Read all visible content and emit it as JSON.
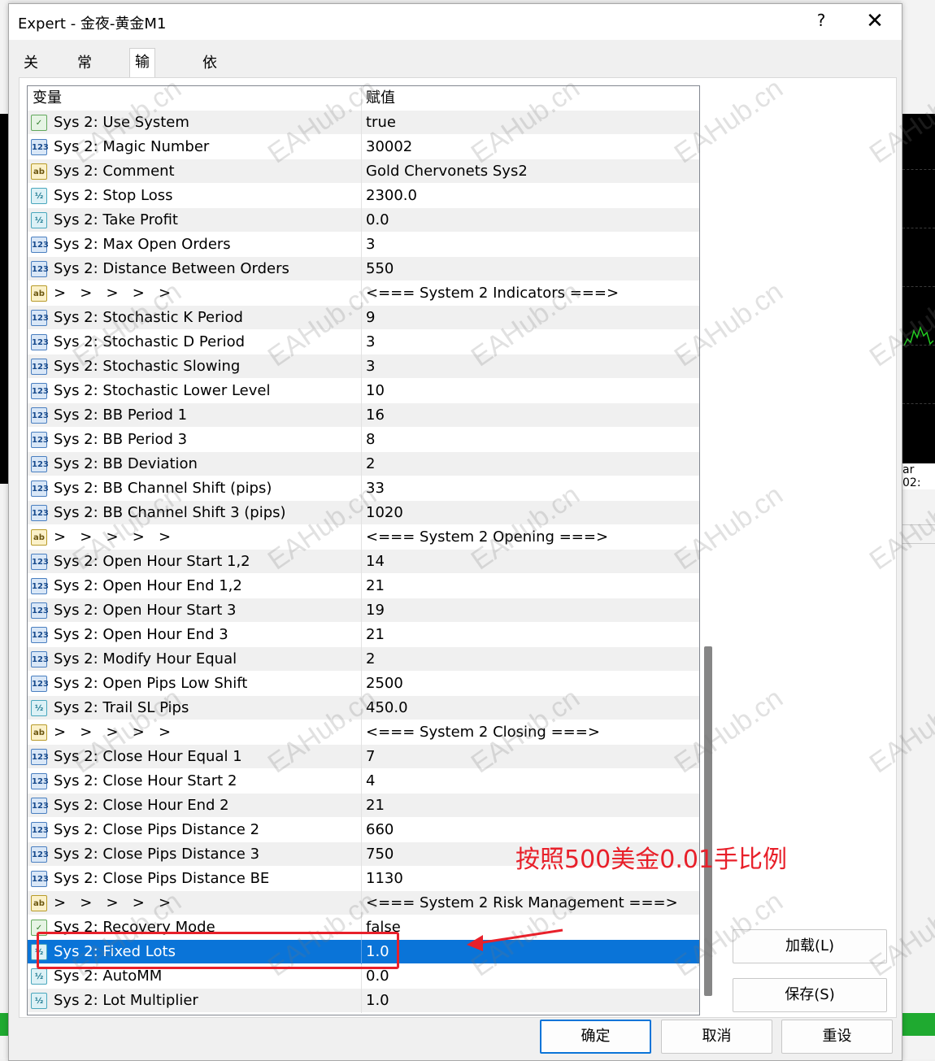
{
  "window": {
    "title": "Expert - 金夜-黄金M1",
    "help": "?",
    "close": "✕"
  },
  "tabs": [
    {
      "label": "关于"
    },
    {
      "label": "常用"
    },
    {
      "label": "输入参数",
      "active": true
    },
    {
      "label": "依存关系"
    }
  ],
  "table": {
    "col_variable": "变量",
    "col_value": "赋值",
    "rows": [
      {
        "type": "bool",
        "icon": "bool-icon",
        "name": "Sys 2: Use System",
        "value": "true"
      },
      {
        "type": "int",
        "icon": "int-icon",
        "name": "Sys 2: Magic Number",
        "value": "30002"
      },
      {
        "type": "str",
        "icon": "string-icon",
        "name": "Sys 2: Comment",
        "value": "Gold Chervonets Sys2"
      },
      {
        "type": "dbl",
        "icon": "double-icon",
        "name": "Sys 2: Stop Loss",
        "value": "2300.0"
      },
      {
        "type": "dbl",
        "icon": "double-icon",
        "name": "Sys 2: Take Profit",
        "value": "0.0"
      },
      {
        "type": "int",
        "icon": "int-icon",
        "name": "Sys 2: Max Open Orders",
        "value": "3"
      },
      {
        "type": "int",
        "icon": "int-icon",
        "name": "Sys 2: Distance Between Orders",
        "value": "550"
      },
      {
        "type": "str",
        "icon": "string-icon",
        "name": ">   >   >   >   >",
        "value": "<=== System 2 Indicators ===>"
      },
      {
        "type": "int",
        "icon": "int-icon",
        "name": "Sys 2: Stochastic K Period",
        "value": "9"
      },
      {
        "type": "int",
        "icon": "int-icon",
        "name": "Sys 2: Stochastic D Period",
        "value": "3"
      },
      {
        "type": "int",
        "icon": "int-icon",
        "name": "Sys 2: Stochastic Slowing",
        "value": "3"
      },
      {
        "type": "int",
        "icon": "int-icon",
        "name": "Sys 2: Stochastic Lower Level",
        "value": "10"
      },
      {
        "type": "int",
        "icon": "int-icon",
        "name": "Sys 2: BB Period 1",
        "value": "16"
      },
      {
        "type": "int",
        "icon": "int-icon",
        "name": "Sys 2: BB Period 3",
        "value": "8"
      },
      {
        "type": "int",
        "icon": "int-icon",
        "name": "Sys 2: BB Deviation",
        "value": "2"
      },
      {
        "type": "int",
        "icon": "int-icon",
        "name": "Sys 2: BB Channel Shift (pips)",
        "value": "33"
      },
      {
        "type": "int",
        "icon": "int-icon",
        "name": "Sys 2: BB Channel Shift 3 (pips)",
        "value": "1020"
      },
      {
        "type": "str",
        "icon": "string-icon",
        "name": ">   >   >   >   >",
        "value": "<=== System 2 Opening ===>"
      },
      {
        "type": "int",
        "icon": "int-icon",
        "name": "Sys 2: Open Hour Start 1,2",
        "value": "14"
      },
      {
        "type": "int",
        "icon": "int-icon",
        "name": "Sys 2: Open Hour End 1,2",
        "value": "21"
      },
      {
        "type": "int",
        "icon": "int-icon",
        "name": "Sys 2: Open Hour Start 3",
        "value": "19"
      },
      {
        "type": "int",
        "icon": "int-icon",
        "name": "Sys 2: Open Hour End 3",
        "value": "21"
      },
      {
        "type": "int",
        "icon": "int-icon",
        "name": "Sys 2: Modify Hour Equal",
        "value": "2"
      },
      {
        "type": "int",
        "icon": "int-icon",
        "name": "Sys 2: Open Pips Low Shift",
        "value": "2500"
      },
      {
        "type": "dbl",
        "icon": "double-icon",
        "name": "Sys 2: Trail SL Pips",
        "value": "450.0"
      },
      {
        "type": "str",
        "icon": "string-icon",
        "name": ">   >   >   >   >",
        "value": "<=== System 2 Closing ===>"
      },
      {
        "type": "int",
        "icon": "int-icon",
        "name": "Sys 2: Close Hour Equal 1",
        "value": "7"
      },
      {
        "type": "int",
        "icon": "int-icon",
        "name": "Sys 2: Close Hour Start 2",
        "value": "4"
      },
      {
        "type": "int",
        "icon": "int-icon",
        "name": "Sys 2: Close Hour End 2",
        "value": "21"
      },
      {
        "type": "int",
        "icon": "int-icon",
        "name": "Sys 2: Close Pips Distance 2",
        "value": "660"
      },
      {
        "type": "int",
        "icon": "int-icon",
        "name": "Sys 2: Close Pips Distance 3",
        "value": "750"
      },
      {
        "type": "int",
        "icon": "int-icon",
        "name": "Sys 2: Close Pips Distance BE",
        "value": "1130"
      },
      {
        "type": "str",
        "icon": "string-icon",
        "name": ">   >   >   >   >",
        "value": "<=== System 2 Risk Management ===>"
      },
      {
        "type": "bool",
        "icon": "bool-icon",
        "name": "Sys 2: Recovery Mode",
        "value": "false"
      },
      {
        "type": "dbl",
        "icon": "double-icon",
        "name": "Sys 2: Fixed Lots",
        "value": "1.0",
        "selected": true
      },
      {
        "type": "dbl",
        "icon": "double-icon",
        "name": "Sys 2: AutoMM",
        "value": "0.0"
      },
      {
        "type": "dbl",
        "icon": "double-icon",
        "name": "Sys 2: Lot Multiplier",
        "value": "1.0"
      }
    ]
  },
  "icon_glyphs": {
    "bool": "✓",
    "int": "123",
    "str": "ab",
    "dbl": "½"
  },
  "buttons": {
    "load": "加载(L)",
    "save": "保存(S)",
    "ok": "确定",
    "cancel": "取消",
    "reset": "重设"
  },
  "annotation": {
    "text": "按照500美金0.01手比例",
    "color": "#e8202a"
  },
  "watermark": "EAHub.cn",
  "background": {
    "time_label": "ar 02:"
  },
  "colors": {
    "selection": "#0a74d8",
    "accent_green": "#1faa30"
  }
}
